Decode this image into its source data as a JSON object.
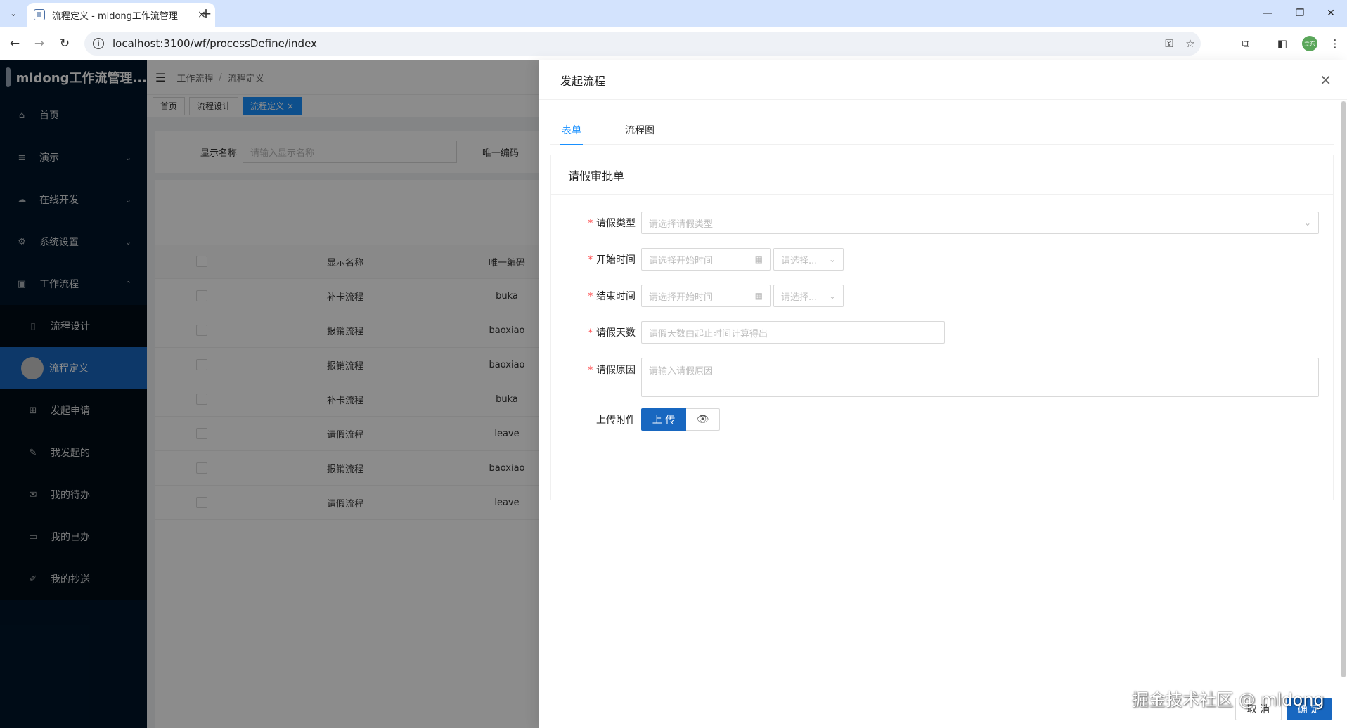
{
  "browser": {
    "tab_title": "流程定义 - mldong工作流管理",
    "tab_close": "×",
    "new_tab": "+",
    "url": "localhost:3100/wf/processDefine/index",
    "profile": "立东"
  },
  "sidebar": {
    "logo_text": "mldong工作流管理...",
    "items": [
      {
        "label": "首页",
        "icon": "home-icon"
      },
      {
        "label": "演示",
        "icon": "list-icon"
      },
      {
        "label": "在线开发",
        "icon": "cloud-icon"
      },
      {
        "label": "系统设置",
        "icon": "gear-icon"
      },
      {
        "label": "工作流程",
        "icon": "flow-icon"
      }
    ],
    "subitems": [
      {
        "label": "流程设计",
        "icon": "file-icon"
      },
      {
        "label": "流程定义",
        "icon": "circle-icon"
      },
      {
        "label": "发起申请",
        "icon": "apps-icon"
      },
      {
        "label": "我发起的",
        "icon": "edit-icon"
      },
      {
        "label": "我的待办",
        "icon": "mail-icon"
      },
      {
        "label": "我的已办",
        "icon": "book-icon"
      },
      {
        "label": "我的抄送",
        "icon": "pen-icon"
      }
    ]
  },
  "header": {
    "breadcrumb": [
      "工作流程",
      "流程定义"
    ]
  },
  "tags": [
    "首页",
    "流程设计",
    "流程定义"
  ],
  "search": {
    "name_label": "显示名称",
    "name_placeholder": "请输入显示名称",
    "code_label": "唯一编码"
  },
  "table": {
    "headers": [
      "显示名称",
      "唯一编码"
    ],
    "rows": [
      [
        "补卡流程",
        "buka"
      ],
      [
        "报销流程",
        "baoxiao"
      ],
      [
        "报销流程",
        "baoxiao"
      ],
      [
        "补卡流程",
        "buka"
      ],
      [
        "请假流程",
        "leave"
      ],
      [
        "报销流程",
        "baoxiao"
      ],
      [
        "请假流程",
        "leave"
      ]
    ]
  },
  "drawer": {
    "title": "发起流程",
    "tabs": [
      "表单",
      "流程图"
    ],
    "form_title": "请假审批单",
    "fields": {
      "leave_type": {
        "label": "请假类型",
        "placeholder": "请选择请假类型"
      },
      "start_time": {
        "label": "开始时间",
        "placeholder": "请选择开始时间",
        "half_placeholder": "请选择..."
      },
      "end_time": {
        "label": "结束时间",
        "placeholder": "请选择开始时间",
        "half_placeholder": "请选择..."
      },
      "days": {
        "label": "请假天数",
        "placeholder": "请假天数由起止时间计算得出"
      },
      "reason": {
        "label": "请假原因",
        "placeholder": "请输入请假原因"
      },
      "attachment": {
        "label": "上传附件",
        "button": "上 传"
      }
    },
    "cancel": "取 消",
    "ok": "确 定"
  },
  "watermark": "掘金技术社区 @ mldong"
}
